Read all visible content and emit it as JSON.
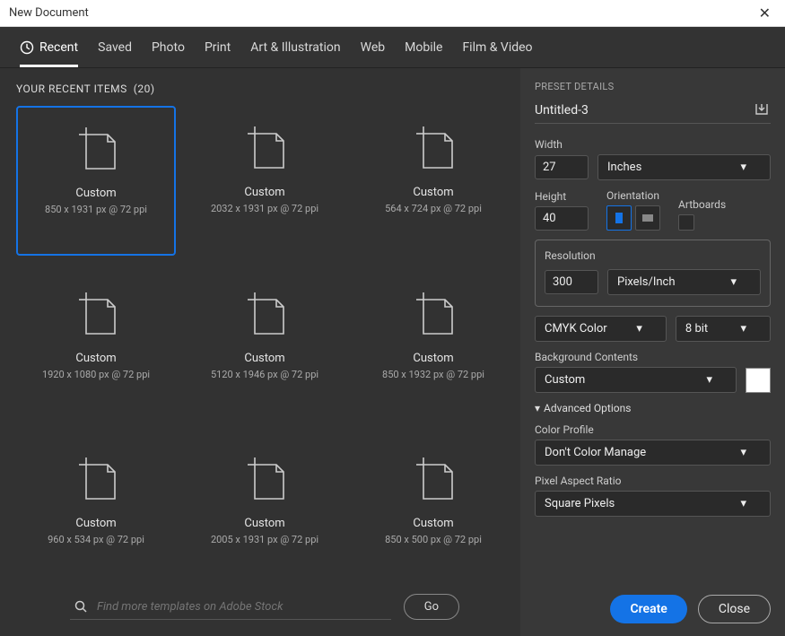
{
  "window": {
    "title": "New Document"
  },
  "tabs": [
    {
      "label": "Recent",
      "active": true
    },
    {
      "label": "Saved"
    },
    {
      "label": "Photo"
    },
    {
      "label": "Print"
    },
    {
      "label": "Art & Illustration"
    },
    {
      "label": "Web"
    },
    {
      "label": "Mobile"
    },
    {
      "label": "Film & Video"
    }
  ],
  "recent": {
    "heading": "YOUR RECENT ITEMS",
    "count": "(20)",
    "items": [
      {
        "title": "Custom",
        "sub": "850 x 1931 px @ 72 ppi",
        "selected": true
      },
      {
        "title": "Custom",
        "sub": "2032 x 1931 px @ 72 ppi"
      },
      {
        "title": "Custom",
        "sub": "564 x 724 px @ 72 ppi"
      },
      {
        "title": "Custom",
        "sub": "1920 x 1080 px @ 72 ppi"
      },
      {
        "title": "Custom",
        "sub": "5120 x 1946 px @ 72 ppi"
      },
      {
        "title": "Custom",
        "sub": "850 x 1932 px @ 72 ppi"
      },
      {
        "title": "Custom",
        "sub": "960 x 534 px @ 72 ppi"
      },
      {
        "title": "Custom",
        "sub": "2005 x 1931 px @ 72 ppi"
      },
      {
        "title": "Custom",
        "sub": "850 x 500 px @ 72 ppi"
      }
    ]
  },
  "search": {
    "placeholder": "Find more templates on Adobe Stock",
    "go": "Go"
  },
  "details": {
    "heading": "PRESET DETAILS",
    "doc_name": "Untitled-3",
    "width_label": "Width",
    "width_value": "27",
    "width_unit": "Inches",
    "height_label": "Height",
    "height_value": "40",
    "orientation_label": "Orientation",
    "artboards_label": "Artboards",
    "resolution_label": "Resolution",
    "resolution_value": "300",
    "resolution_unit": "Pixels/Inch",
    "color_mode": "CMYK Color",
    "bit_depth": "8 bit",
    "bg_label": "Background Contents",
    "bg_value": "Custom",
    "adv_label": "Advanced Options",
    "profile_label": "Color Profile",
    "profile_value": "Don't Color Manage",
    "par_label": "Pixel Aspect Ratio",
    "par_value": "Square Pixels"
  },
  "buttons": {
    "create": "Create",
    "close": "Close"
  },
  "colors": {
    "accent": "#1473e6"
  }
}
